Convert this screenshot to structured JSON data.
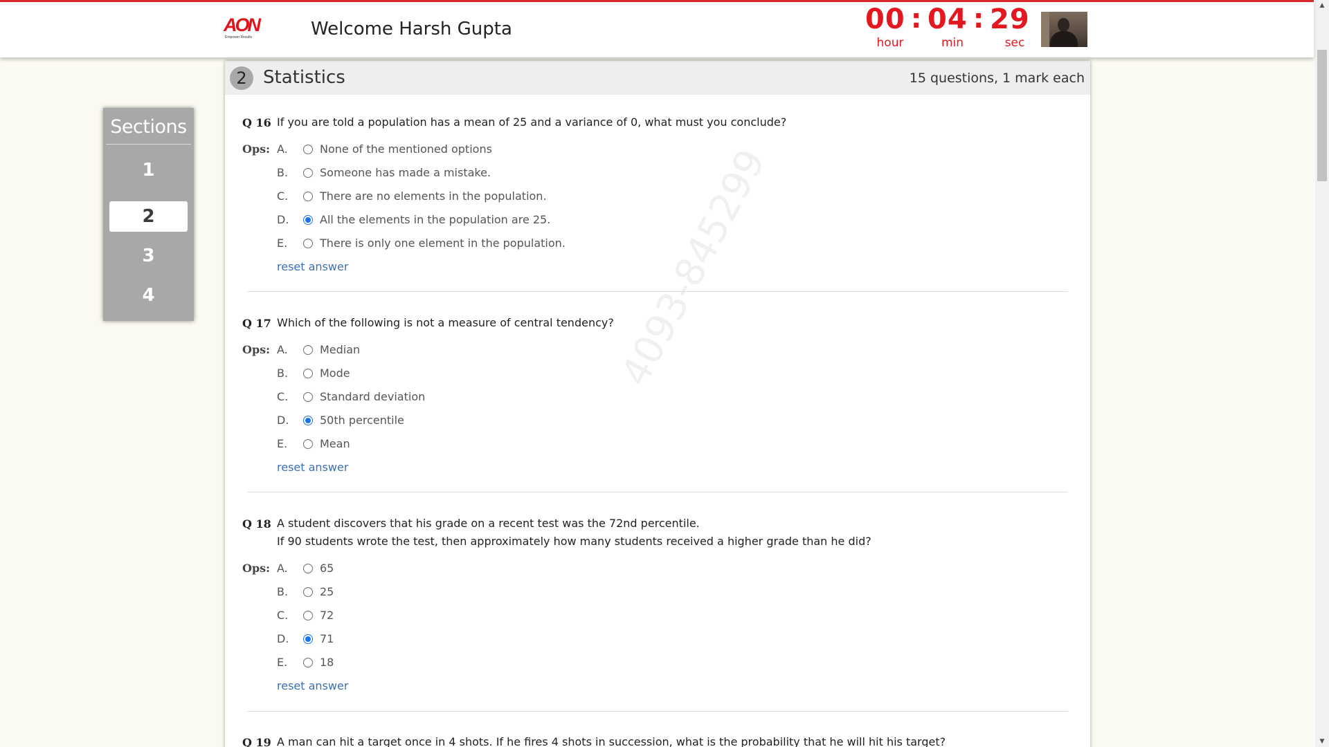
{
  "header": {
    "logo_text": "AON",
    "logo_tagline": "Empower Results",
    "welcome": "Welcome Harsh Gupta"
  },
  "timer": {
    "hours": "00",
    "minutes": "04",
    "seconds": "29",
    "separator": ":",
    "hour_label": "hour",
    "min_label": "min",
    "sec_label": "sec"
  },
  "sidebar": {
    "title": "Sections",
    "items": [
      {
        "label": "1",
        "active": false
      },
      {
        "label": "2",
        "active": true
      },
      {
        "label": "3",
        "active": false
      },
      {
        "label": "4",
        "active": false
      }
    ]
  },
  "section": {
    "number": "2",
    "name": "Statistics",
    "info": "15 questions, 1 mark each"
  },
  "ops_label": "Ops:",
  "reset_label": "reset answer",
  "watermark": "4093-845299",
  "questions": [
    {
      "num": "Q 16",
      "text": "If you are told a population has a mean of 25 and a variance of 0, what must you conclude?",
      "text2": "",
      "options": [
        {
          "letter": "A.",
          "text": "None of the mentioned options",
          "selected": false
        },
        {
          "letter": "B.",
          "text": "Someone has made a mistake.",
          "selected": false
        },
        {
          "letter": "C.",
          "text": "There are no elements in the population.",
          "selected": false
        },
        {
          "letter": "D.",
          "text": "All the elements in the population are 25.",
          "selected": true
        },
        {
          "letter": "E.",
          "text": "There is only one element in the population.",
          "selected": false
        }
      ]
    },
    {
      "num": "Q 17",
      "text": "Which of the following is not a measure of central tendency?",
      "text2": "",
      "options": [
        {
          "letter": "A.",
          "text": "Median",
          "selected": false
        },
        {
          "letter": "B.",
          "text": "Mode",
          "selected": false
        },
        {
          "letter": "C.",
          "text": "Standard deviation",
          "selected": false
        },
        {
          "letter": "D.",
          "text": "50th percentile",
          "selected": true
        },
        {
          "letter": "E.",
          "text": "Mean",
          "selected": false
        }
      ]
    },
    {
      "num": "Q 18",
      "text": "A student discovers that his grade on a recent test was the 72nd percentile.",
      "text2": "If 90 students wrote the test, then approximately how many students received a higher grade than he did?",
      "options": [
        {
          "letter": "A.",
          "text": "65",
          "selected": false
        },
        {
          "letter": "B.",
          "text": "25",
          "selected": false
        },
        {
          "letter": "C.",
          "text": "72",
          "selected": false
        },
        {
          "letter": "D.",
          "text": "71",
          "selected": true
        },
        {
          "letter": "E.",
          "text": "18",
          "selected": false
        }
      ]
    },
    {
      "num": "Q 19",
      "text": "A man can hit a target once in 4 shots. If he fires 4 shots in succession, what is the probability that he will hit his target?",
      "text2": "",
      "options": []
    }
  ]
}
